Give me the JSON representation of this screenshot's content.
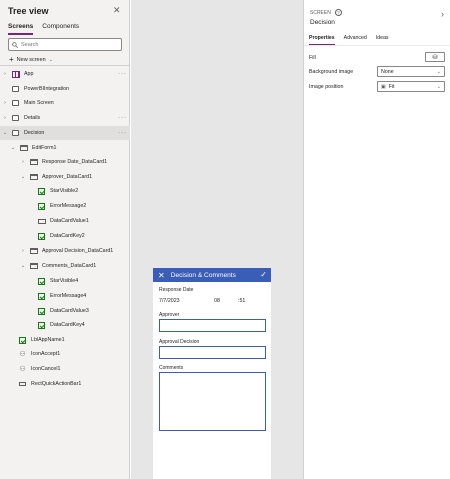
{
  "tree": {
    "title": "Tree view",
    "close_icon": "close-icon",
    "tabs": [
      {
        "label": "Screens"
      },
      {
        "label": "Components"
      }
    ],
    "search_placeholder": "Search",
    "new_screen_label": "New screen",
    "items": [
      {
        "label": "App"
      },
      {
        "label": "PowerBIIntegration"
      },
      {
        "label": "Main Screen"
      },
      {
        "label": "Details"
      },
      {
        "label": "Decision"
      },
      {
        "label": "EditForm1"
      },
      {
        "label": "Response Date_DataCard1"
      },
      {
        "label": "Approver_DataCard1"
      },
      {
        "label": "StarVisible2"
      },
      {
        "label": "ErrorMessage2"
      },
      {
        "label": "DataCardValue1"
      },
      {
        "label": "DataCardKey2"
      },
      {
        "label": "Approval Decision_DataCard1"
      },
      {
        "label": "Comments_DataCard1"
      },
      {
        "label": "StarVisible4"
      },
      {
        "label": "ErrorMessage4"
      },
      {
        "label": "DataCardValue3"
      },
      {
        "label": "DataCardKey4"
      },
      {
        "label": "LblAppName1"
      },
      {
        "label": "IconAccept1"
      },
      {
        "label": "IconCancel1"
      },
      {
        "label": "RectQuickActionBar1"
      }
    ]
  },
  "device": {
    "header_title": "Decision & Comments",
    "response_date_label": "Response Date",
    "date_value": "7/7/2023",
    "hour_value": "08",
    "minute_value": ":51",
    "approver_label": "Approver",
    "approval_decision_label": "Approval Decision",
    "comments_label": "Comments",
    "header_color": "#3a5db8"
  },
  "props": {
    "kind": "SCREEN",
    "name": "Decision",
    "tabs": [
      {
        "label": "Properties"
      },
      {
        "label": "Advanced"
      },
      {
        "label": "Ideas"
      }
    ],
    "fill_label": "Fill",
    "background_image_label": "Background image",
    "background_image_value": "None",
    "image_position_label": "Image position",
    "image_position_value": "Fit"
  },
  "colors": {
    "accent": "#742774",
    "form_blue": "#3a5db8"
  }
}
